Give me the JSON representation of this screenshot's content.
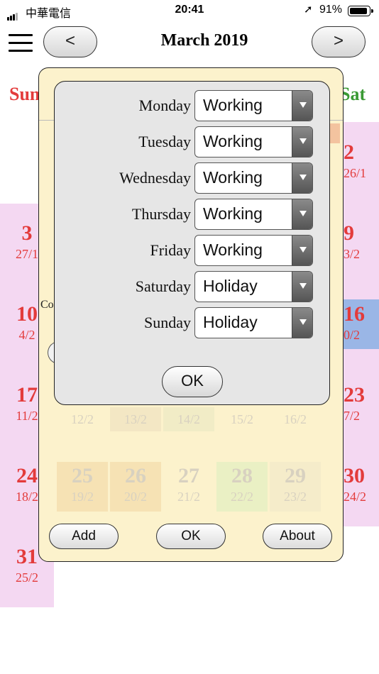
{
  "status_bar": {
    "carrier": "中華電信",
    "time": "20:41",
    "battery_percent": "91%",
    "battery_level": 0.91,
    "location_icon": "location-arrow-icon"
  },
  "header": {
    "menu_icon": "hamburger-menu-icon",
    "prev_label": "<",
    "next_label": ">",
    "title": "March 2019"
  },
  "calendar": {
    "day_headers": {
      "sun": {
        "label": "Sun",
        "color": "#e33b3b"
      },
      "sat": {
        "label": "Sat",
        "color": "#3a9a34"
      }
    },
    "sunday_cells": [
      {
        "day": "3",
        "lunar": "27/1"
      },
      {
        "day": "10",
        "lunar": "4/2"
      },
      {
        "day": "17",
        "lunar": "11/2"
      },
      {
        "day": "24",
        "lunar": "18/2"
      },
      {
        "day": "31",
        "lunar": "25/2"
      }
    ],
    "saturday_cells": [
      {
        "day": "2",
        "lunar": "26/1"
      },
      {
        "day": "9",
        "lunar": "3/2"
      },
      {
        "day": "16",
        "lunar": "0/2",
        "highlight": "#9ab6e6"
      },
      {
        "day": "23",
        "lunar": "7/2"
      },
      {
        "day": "30",
        "lunar": "24/2"
      }
    ],
    "faded_lunar_row": [
      "12/2",
      "13/2",
      "14/2",
      "15/2",
      "16/2"
    ],
    "faded_cells": [
      {
        "day": "25",
        "lunar": "19/2",
        "bg": "#f6e2b4"
      },
      {
        "day": "26",
        "lunar": "20/2",
        "bg": "#f6e2b4"
      },
      {
        "day": "27",
        "lunar": "21/2",
        "bg": "#fcf2cc"
      },
      {
        "day": "28",
        "lunar": "22/2",
        "bg": "#eaf0c4"
      },
      {
        "day": "29",
        "lunar": "23/2",
        "bg": "#f5ecca"
      }
    ],
    "colors": {
      "weekend_column": "#f4d8f2",
      "weekend_text": "#e33b3b"
    }
  },
  "settings_dialog": {
    "partial_label": "Co",
    "buttons": {
      "add": "Add",
      "ok": "OK",
      "about": "About"
    }
  },
  "week_dialog": {
    "days": [
      {
        "label": "Monday",
        "value": "Working"
      },
      {
        "label": "Tuesday",
        "value": "Working"
      },
      {
        "label": "Wednesday",
        "value": "Working"
      },
      {
        "label": "Thursday",
        "value": "Working"
      },
      {
        "label": "Friday",
        "value": "Working"
      },
      {
        "label": "Saturday",
        "value": "Holiday"
      },
      {
        "label": "Sunday",
        "value": "Holiday"
      }
    ],
    "ok_label": "OK"
  }
}
